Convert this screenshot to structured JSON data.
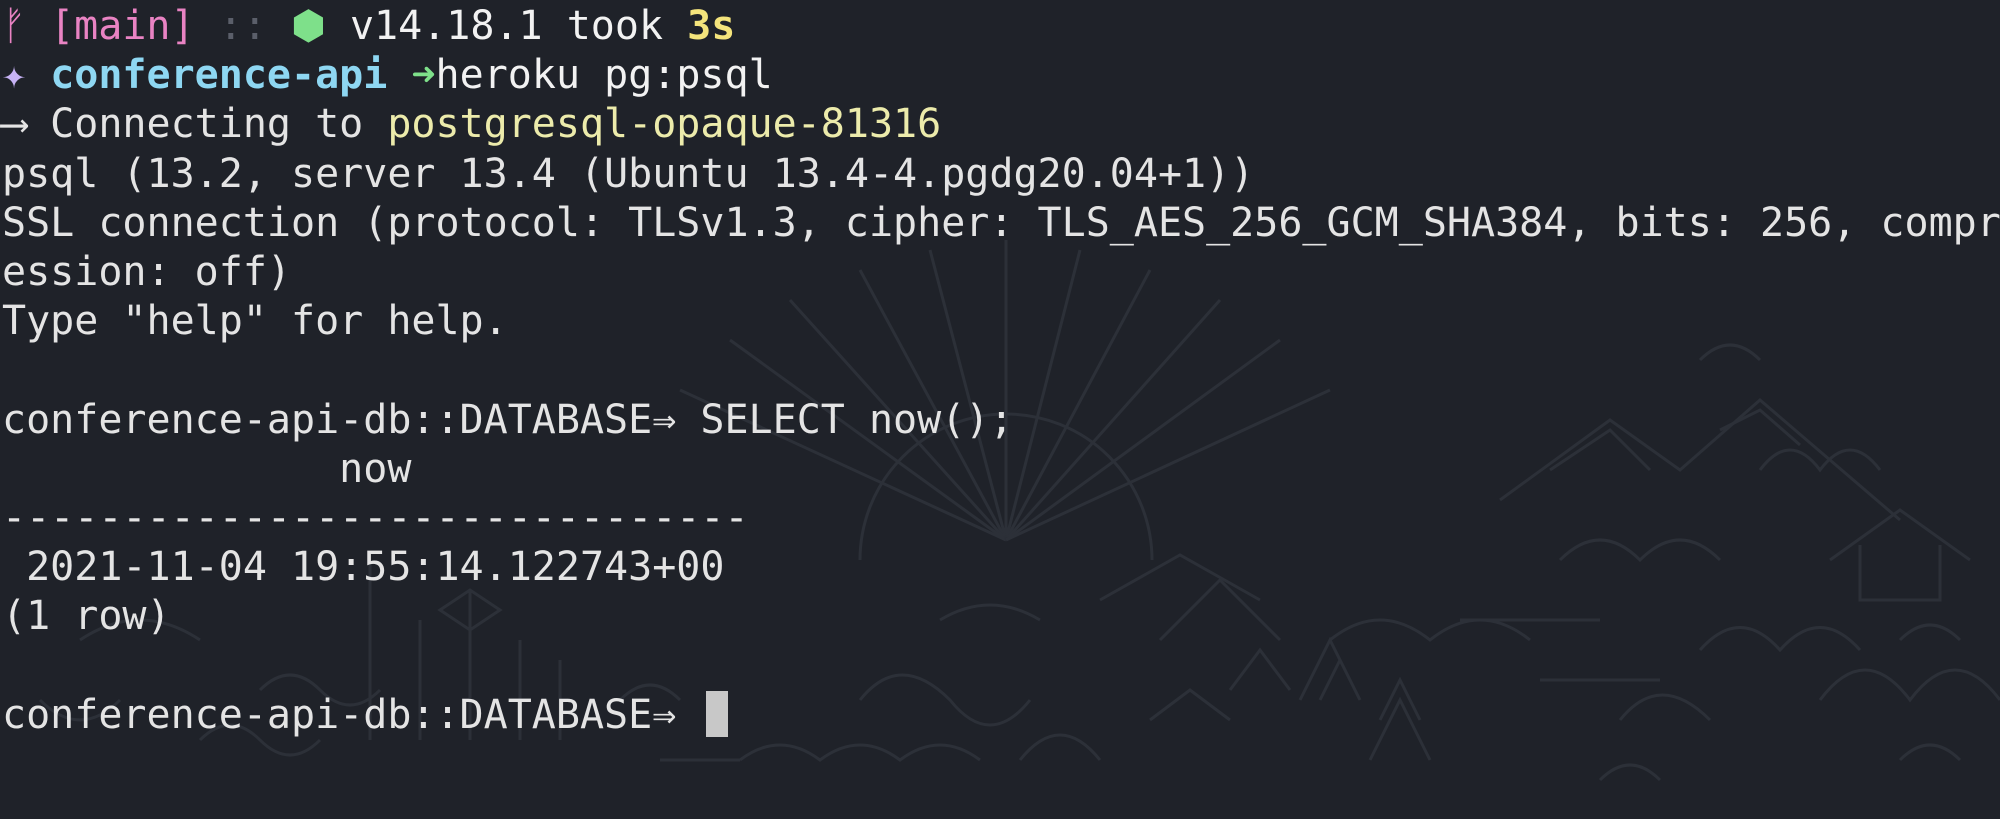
{
  "prompt": {
    "git_icon": "git-branch-icon",
    "branch": "[main]",
    "separator": "::",
    "node_icon": "node-hexagon-icon",
    "node_version": "v14.18.1",
    "took_label": "took",
    "duration": "3s"
  },
  "command_line": {
    "star_icon": "sparkle-icon",
    "directory": "conference-api",
    "arrow_icon": "arrow-right-icon",
    "command": "heroku pg:psql"
  },
  "output": {
    "connecting_prefix": "⟶ Connecting to ",
    "connecting_target": "postgresql-opaque-81316",
    "psql_version": "psql (13.2, server 13.4 (Ubuntu 13.4-4.pgdg20.04+1))",
    "ssl_line_1": "SSL connection (protocol: TLSv1.3, cipher: TLS_AES_256_GCM_SHA384, bits: 256, compr",
    "ssl_line_2": "ession: off)",
    "help_line": "Type \"help\" for help."
  },
  "query": {
    "db_prompt": "conference-api-db::DATABASE⇒",
    "sql": "SELECT now();",
    "column_header": "              now",
    "divider": "-------------------------------",
    "result_value": " 2021-11-04 19:55:14.122743+00",
    "row_count": "(1 row)"
  },
  "final_prompt": {
    "db_prompt": "conference-api-db::DATABASE⇒"
  },
  "colors": {
    "background": "#1f2229",
    "branch": "#e983c3",
    "node": "#7ee08a",
    "duration": "#f4e47c",
    "directory": "#8ed7f2",
    "host": "#ecebab",
    "text": "#e4e4e4"
  }
}
